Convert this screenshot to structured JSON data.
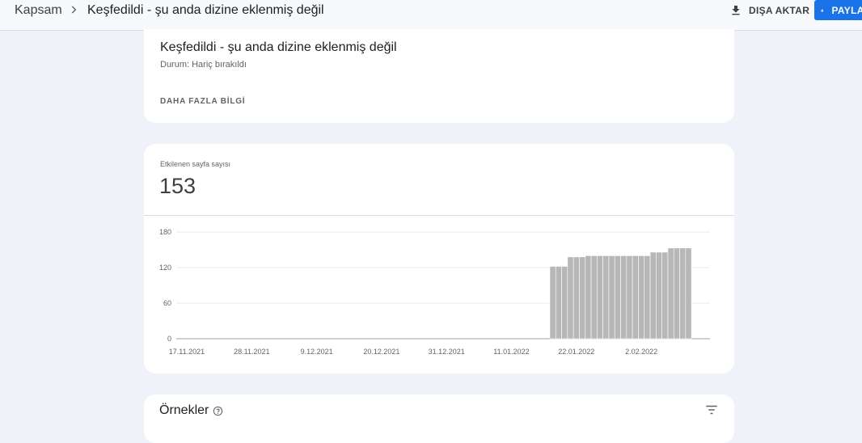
{
  "header": {
    "breadcrumb_root": "Kapsam",
    "breadcrumb_current": "Keşfedildi - şu anda dizine eklenmiş değil",
    "export_label": "DIŞA AKTAR",
    "share_label": "PAYLAŞ"
  },
  "summary": {
    "title": "Keşfedildi - şu anda dizine eklenmiş değil",
    "status": "Durum: Hariç bırakıldı",
    "more_label": "DAHA FAZLA BİLGİ"
  },
  "metric": {
    "label": "Etkilenen sayfa sayısı",
    "value": "153"
  },
  "chart_data": {
    "type": "bar",
    "title": "",
    "xlabel": "",
    "ylabel": "",
    "ylim": [
      0,
      180
    ],
    "y_ticks": [
      "180",
      "120",
      "60",
      "0"
    ],
    "x_tick_labels": [
      "17.11.2021",
      "28.11.2021",
      "9.12.2021",
      "20.12.2021",
      "31.12.2021",
      "11.01.2022",
      "22.01.2022",
      "2.02.2022"
    ],
    "bar_start_date": "18.01.2022",
    "values": [
      122,
      122,
      122,
      138,
      138,
      138,
      140,
      140,
      140,
      140,
      140,
      140,
      140,
      140,
      140,
      140,
      140,
      146,
      146,
      146,
      153,
      153,
      153,
      153
    ],
    "bar_color": "#b7b7b7",
    "grid": true
  },
  "examples": {
    "title": "Örnekler"
  },
  "colors": {
    "accent": "#1a73e8",
    "background": "#eff2f9"
  },
  "icons": {
    "breadcrumb_separator": "chevron-right-icon",
    "export": "download-icon",
    "share": "lock-icon",
    "help": "help-icon",
    "filter": "filter-icon"
  }
}
